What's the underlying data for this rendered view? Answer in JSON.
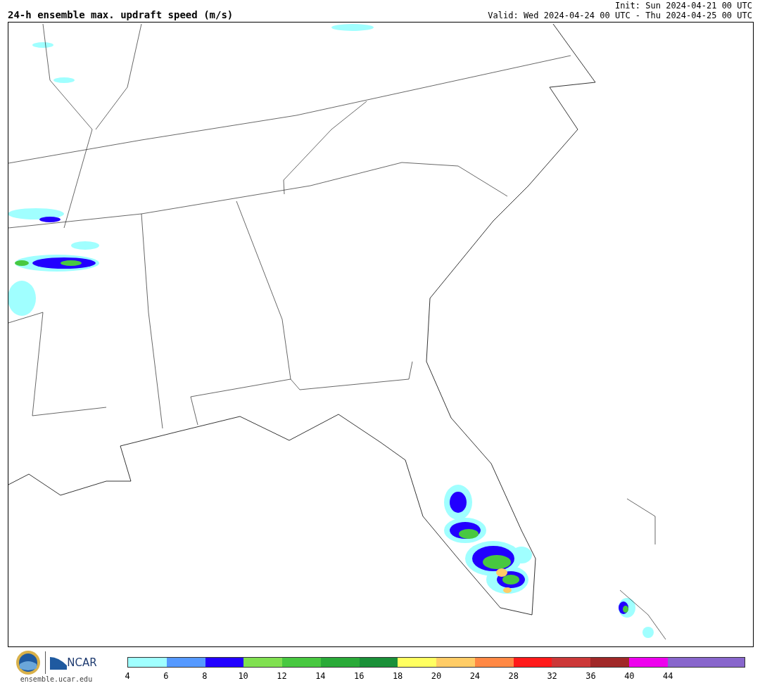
{
  "title": "24-h ensemble max. updraft speed (m/s)",
  "init": "Init: Sun 2024-04-21 00 UTC",
  "valid": "Valid: Wed 2024-04-24 00 UTC - Thu 2024-04-25 00 UTC",
  "logo_text": "NCAR",
  "url": "ensemble.ucar.edu",
  "colorbar": {
    "segments": [
      {
        "color": "#a0ffff"
      },
      {
        "color": "#5599ff"
      },
      {
        "color": "#2200ff"
      },
      {
        "color": "#80e050"
      },
      {
        "color": "#48c840"
      },
      {
        "color": "#2aaa38"
      },
      {
        "color": "#1a9038"
      },
      {
        "color": "#ffff60"
      },
      {
        "color": "#ffcc66"
      },
      {
        "color": "#ff8844"
      },
      {
        "color": "#ff1a1a"
      },
      {
        "color": "#cc3838"
      },
      {
        "color": "#a02828"
      },
      {
        "color": "#ee00ee"
      },
      {
        "color": "#8866cc"
      },
      {
        "color": "#8866cc"
      }
    ],
    "ticks": [
      "4",
      "6",
      "8",
      "10",
      "12",
      "14",
      "16",
      "18",
      "20",
      "24",
      "28",
      "32",
      "36",
      "40",
      "44"
    ]
  }
}
